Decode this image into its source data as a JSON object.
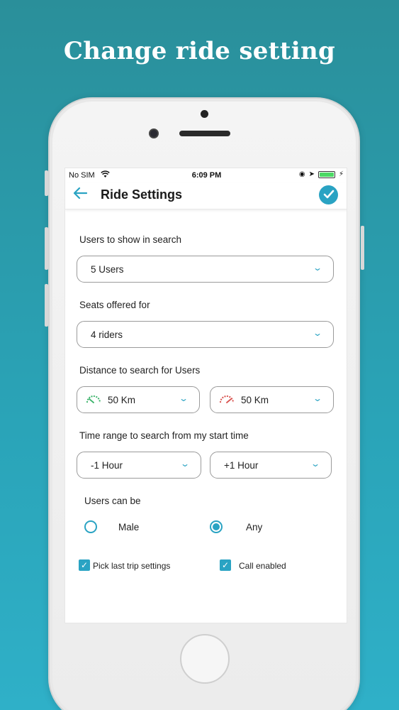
{
  "promo": {
    "headline": "Change ride setting"
  },
  "status_bar": {
    "carrier": "No SIM",
    "time": "6:09 PM"
  },
  "nav": {
    "title": "Ride Settings"
  },
  "form": {
    "users_search": {
      "label": "Users to show in search",
      "value": "5 Users"
    },
    "seats": {
      "label": "Seats offered for",
      "value": "4 riders"
    },
    "distance": {
      "label": "Distance to search for Users",
      "min_value": "50 Km",
      "max_value": "50 Km"
    },
    "time_range": {
      "label": "Time range to search from my start time",
      "before_value": "-1 Hour",
      "after_value": "+1 Hour"
    },
    "gender": {
      "label": "Users can be",
      "options": [
        "Male",
        "Any"
      ],
      "selected": "Any"
    },
    "checks": {
      "pick_last": "Pick last trip settings",
      "call_enabled": "Call enabled"
    }
  },
  "colors": {
    "accent": "#2aa3c3",
    "background": "#2aa4b8"
  }
}
